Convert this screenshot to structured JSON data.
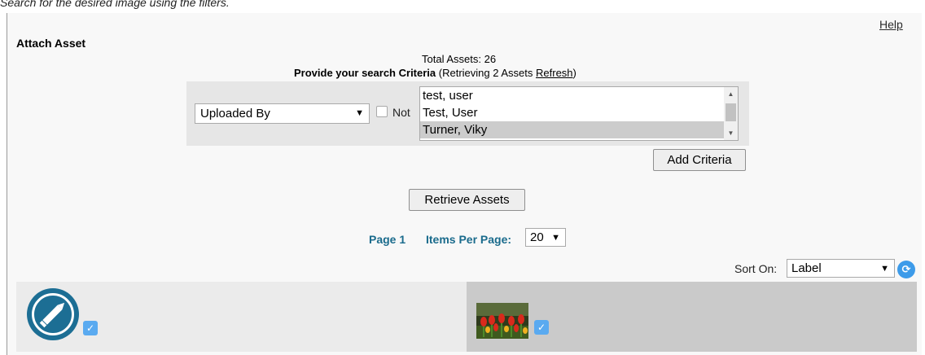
{
  "instruction": "Search for the desired image using the filters.",
  "help_label": "Help",
  "title": "Attach Asset",
  "total_assets": "Total Assets: 26",
  "criteria": {
    "prompt_prefix": "Provide your search",
    "prompt_bold": "Criteria",
    "retrieving_text": "(Retrieving 2 Assets",
    "refresh_label": "Refresh",
    "retrieving_close": ")",
    "field_selected": "Uploaded By",
    "not_label": "Not",
    "not_checked": false,
    "values": [
      {
        "label": "test, user",
        "selected": false
      },
      {
        "label": "Test, User",
        "selected": false
      },
      {
        "label": "Turner, Viky",
        "selected": true
      }
    ],
    "add_button": "Add Criteria"
  },
  "retrieve_button": "Retrieve Assets",
  "pagination": {
    "page_label": "Page 1",
    "items_per_page_label": "Items Per Page:",
    "items_per_page_value": "20"
  },
  "sort": {
    "label": "Sort On:",
    "value": "Label"
  },
  "results": [
    {
      "icon": "edit-pencil-icon",
      "checked": true
    },
    {
      "icon": "tulips-thumbnail",
      "checked": true
    }
  ],
  "colors": {
    "link_blue": "#1a6b8c",
    "edit_icon_blue": "#1c6e94",
    "check_blue": "#5aaaf0",
    "criteria_bg": "#e6e6e6",
    "selected_option": "#cccccc"
  }
}
